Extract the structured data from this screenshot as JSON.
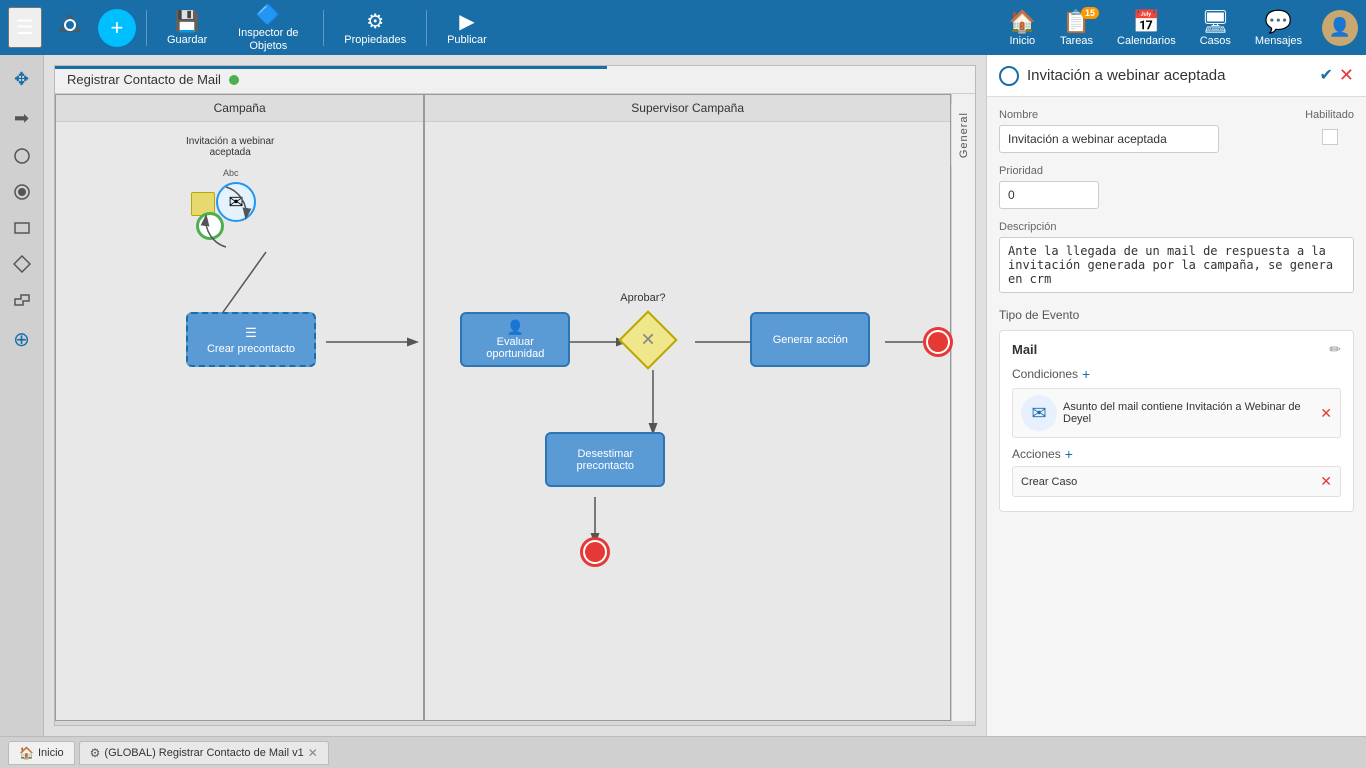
{
  "toolbar": {
    "save_label": "Guardar",
    "inspector_label": "Inspector de Objetos",
    "properties_label": "Propiedades",
    "publish_label": "Publicar",
    "add_tooltip": "+"
  },
  "nav": {
    "inicio_label": "Inicio",
    "tareas_label": "Tareas",
    "calendarios_label": "Calendarios",
    "casos_label": "Casos",
    "mensajes_label": "Mensajes",
    "tareas_badge": "15"
  },
  "diagram": {
    "process_title": "Registrar Contacto de Mail",
    "status": "active",
    "swimlanes": [
      {
        "id": "campana",
        "label": "Campaña"
      },
      {
        "id": "supervisor",
        "label": "Supervisor Campaña"
      },
      {
        "id": "extra",
        "label": ""
      }
    ],
    "nodes": [
      {
        "id": "inv",
        "label": "Invitación a webinar aceptada",
        "type": "event",
        "selected": true
      },
      {
        "id": "crear",
        "label": "Crear precontacto",
        "type": "task"
      },
      {
        "id": "evaluar",
        "label": "Evaluar oportunidad",
        "type": "task"
      },
      {
        "id": "aprobar",
        "label": "Aprobar?",
        "type": "gateway"
      },
      {
        "id": "generar",
        "label": "Generar acción",
        "type": "task"
      },
      {
        "id": "desestimar",
        "label": "Desestimar precontacto",
        "type": "task"
      }
    ]
  },
  "panel": {
    "title": "Invitación a webinar aceptada",
    "tab": "General",
    "nombre_label": "Nombre",
    "nombre_value": "Invitación a webinar aceptada",
    "habilitado_label": "Habilitado",
    "prioridad_label": "Prioridad",
    "prioridad_value": "0",
    "descripcion_label": "Descripción",
    "descripcion_value": "Ante la llegada de un mail de respuesta a la invitación generada por la campaña, se genera en crm",
    "tipo_evento_label": "Tipo de Evento",
    "event_card": {
      "title": "Mail",
      "condiciones_label": "Condiciones",
      "condition_text": "Asunto del mail contiene Invitación a Webinar de Deyel",
      "acciones_label": "Acciones",
      "action_text": "Crear Caso"
    }
  },
  "bottom_tabs": [
    {
      "id": "home",
      "label": "Inicio",
      "icon": "🏠",
      "closeable": false
    },
    {
      "id": "global",
      "label": "(GLOBAL) Registrar Contacto de Mail v1",
      "icon": "⚙",
      "closeable": true
    }
  ]
}
